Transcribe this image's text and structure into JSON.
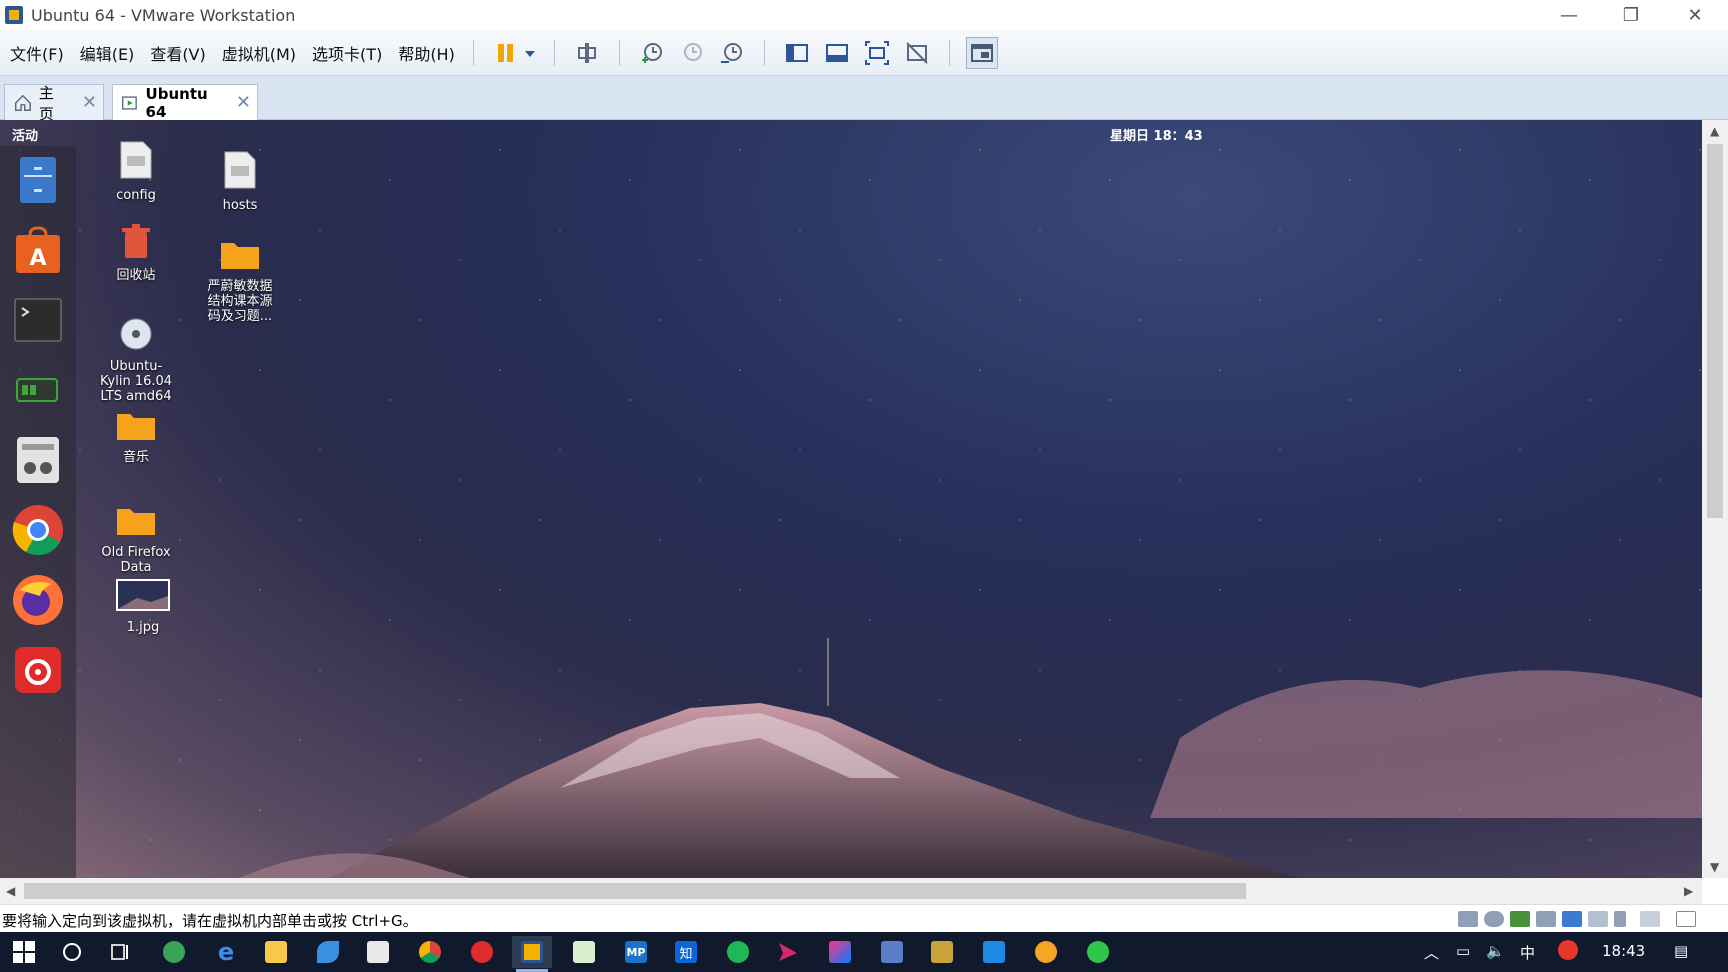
{
  "window": {
    "title": "Ubuntu 64  - VMware Workstation"
  },
  "menu": [
    "文件(F)",
    "编辑(E)",
    "查看(V)",
    "虚拟机(M)",
    "选项卡(T)",
    "帮助(H)"
  ],
  "tabs": [
    {
      "label": "主页",
      "icon": "home-icon"
    },
    {
      "label": "Ubuntu 64",
      "icon": "vm-icon"
    }
  ],
  "guest": {
    "activities": "活动",
    "clock": "星期日 18：43",
    "desktop_icons": [
      {
        "label": "config",
        "icon": "text-file-icon"
      },
      {
        "label": "hosts",
        "icon": "text-file-icon"
      },
      {
        "label": "回收站",
        "icon": "trash-icon"
      },
      {
        "label": "严蔚敏数据\n结构课本源\n码及习题...",
        "icon": "folder-icon"
      },
      {
        "label": "Ubuntu-\nKylin 16.04\nLTS amd64",
        "icon": "disc-icon"
      },
      {
        "label": "音乐",
        "icon": "folder-icon"
      },
      {
        "label": "Old Firefox\nData",
        "icon": "folder-icon"
      },
      {
        "label": "1.jpg",
        "icon": "image-icon"
      }
    ],
    "dock": [
      "files-icon",
      "software-center-icon",
      "terminal-icon",
      "system-monitor-icon",
      "settings-icon",
      "chrome-icon",
      "firefox-icon",
      "netease-music-icon"
    ]
  },
  "status": {
    "message": "要将输入定向到该虚拟机，请在虚拟机内部单击或按 Ctrl+G。"
  },
  "taskbar": {
    "clock": "18:43",
    "ime": "中",
    "zhihu_label": "知",
    "mp_label": "MP"
  }
}
